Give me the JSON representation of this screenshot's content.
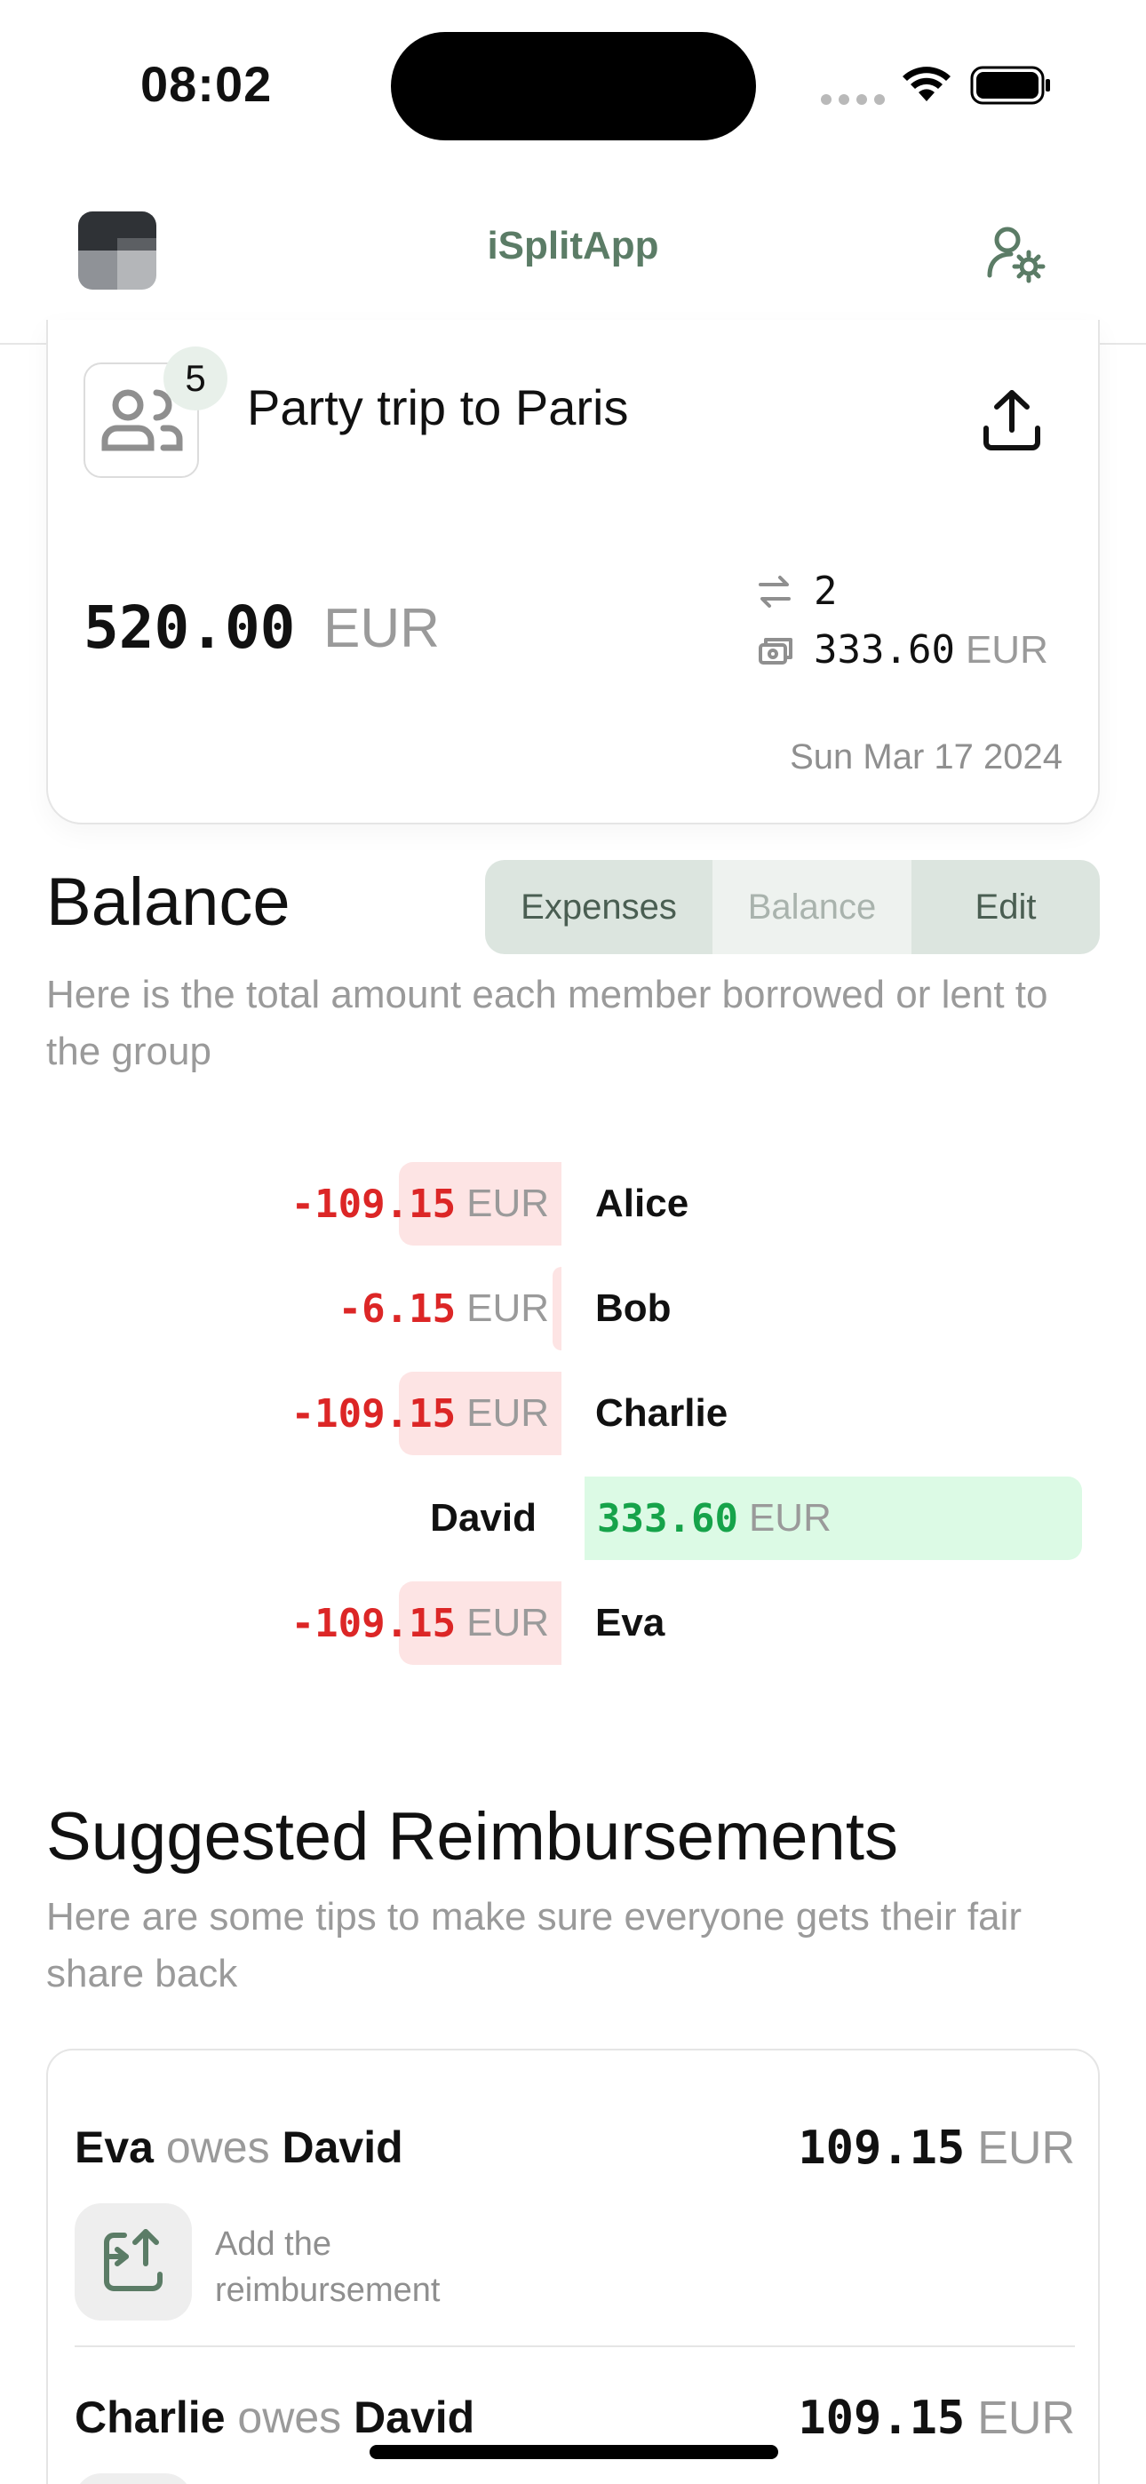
{
  "status_bar": {
    "time": "08:02"
  },
  "header": {
    "app_name": "iSplitApp"
  },
  "group": {
    "name": "Party trip to Paris",
    "member_count": "5",
    "total_amount": "520.00",
    "currency": "EUR",
    "transactions": "2",
    "your_spending": "333.60",
    "date": "Sun Mar 17 2024"
  },
  "balance": {
    "title": "Balance",
    "description": "Here is the total amount each member borrowed or lent to the group",
    "tabs": [
      {
        "label": "Expenses",
        "active": false
      },
      {
        "label": "Balance",
        "active": true
      },
      {
        "label": "Edit",
        "active": false
      }
    ],
    "rows": [
      {
        "name": "Alice",
        "amount": "-109.15",
        "value": -109.15,
        "currency": "EUR"
      },
      {
        "name": "Bob",
        "amount": "-6.15",
        "value": -6.15,
        "currency": "EUR"
      },
      {
        "name": "Charlie",
        "amount": "-109.15",
        "value": -109.15,
        "currency": "EUR"
      },
      {
        "name": "David",
        "amount": "333.60",
        "value": 333.6,
        "currency": "EUR"
      },
      {
        "name": "Eva",
        "amount": "-109.15",
        "value": -109.15,
        "currency": "EUR"
      }
    ]
  },
  "reimbursements": {
    "title": "Suggested Reimbursements",
    "description": "Here are some tips to make sure everyone gets their fair share back",
    "owes_word": "owes",
    "action_label": "Add the reimbursement",
    "items": [
      {
        "from": "Eva",
        "to": "David",
        "amount": "109.15",
        "currency": "EUR"
      },
      {
        "from": "Charlie",
        "to": "David",
        "amount": "109.15",
        "currency": "EUR"
      }
    ]
  },
  "icons": {
    "logo": "app-logo-icon",
    "settings": "user-settings-icon",
    "group": "users-icon",
    "share": "share-upload-icon",
    "transactions": "arrows-swap-icon",
    "spending": "wallet-icon",
    "reimburse": "reimburse-icon"
  },
  "colors": {
    "brand": "#5b7c66",
    "negative": "#dc2626",
    "negative_bg": "#fde4e4",
    "positive": "#16a34a",
    "positive_bg": "#dcfae5"
  }
}
